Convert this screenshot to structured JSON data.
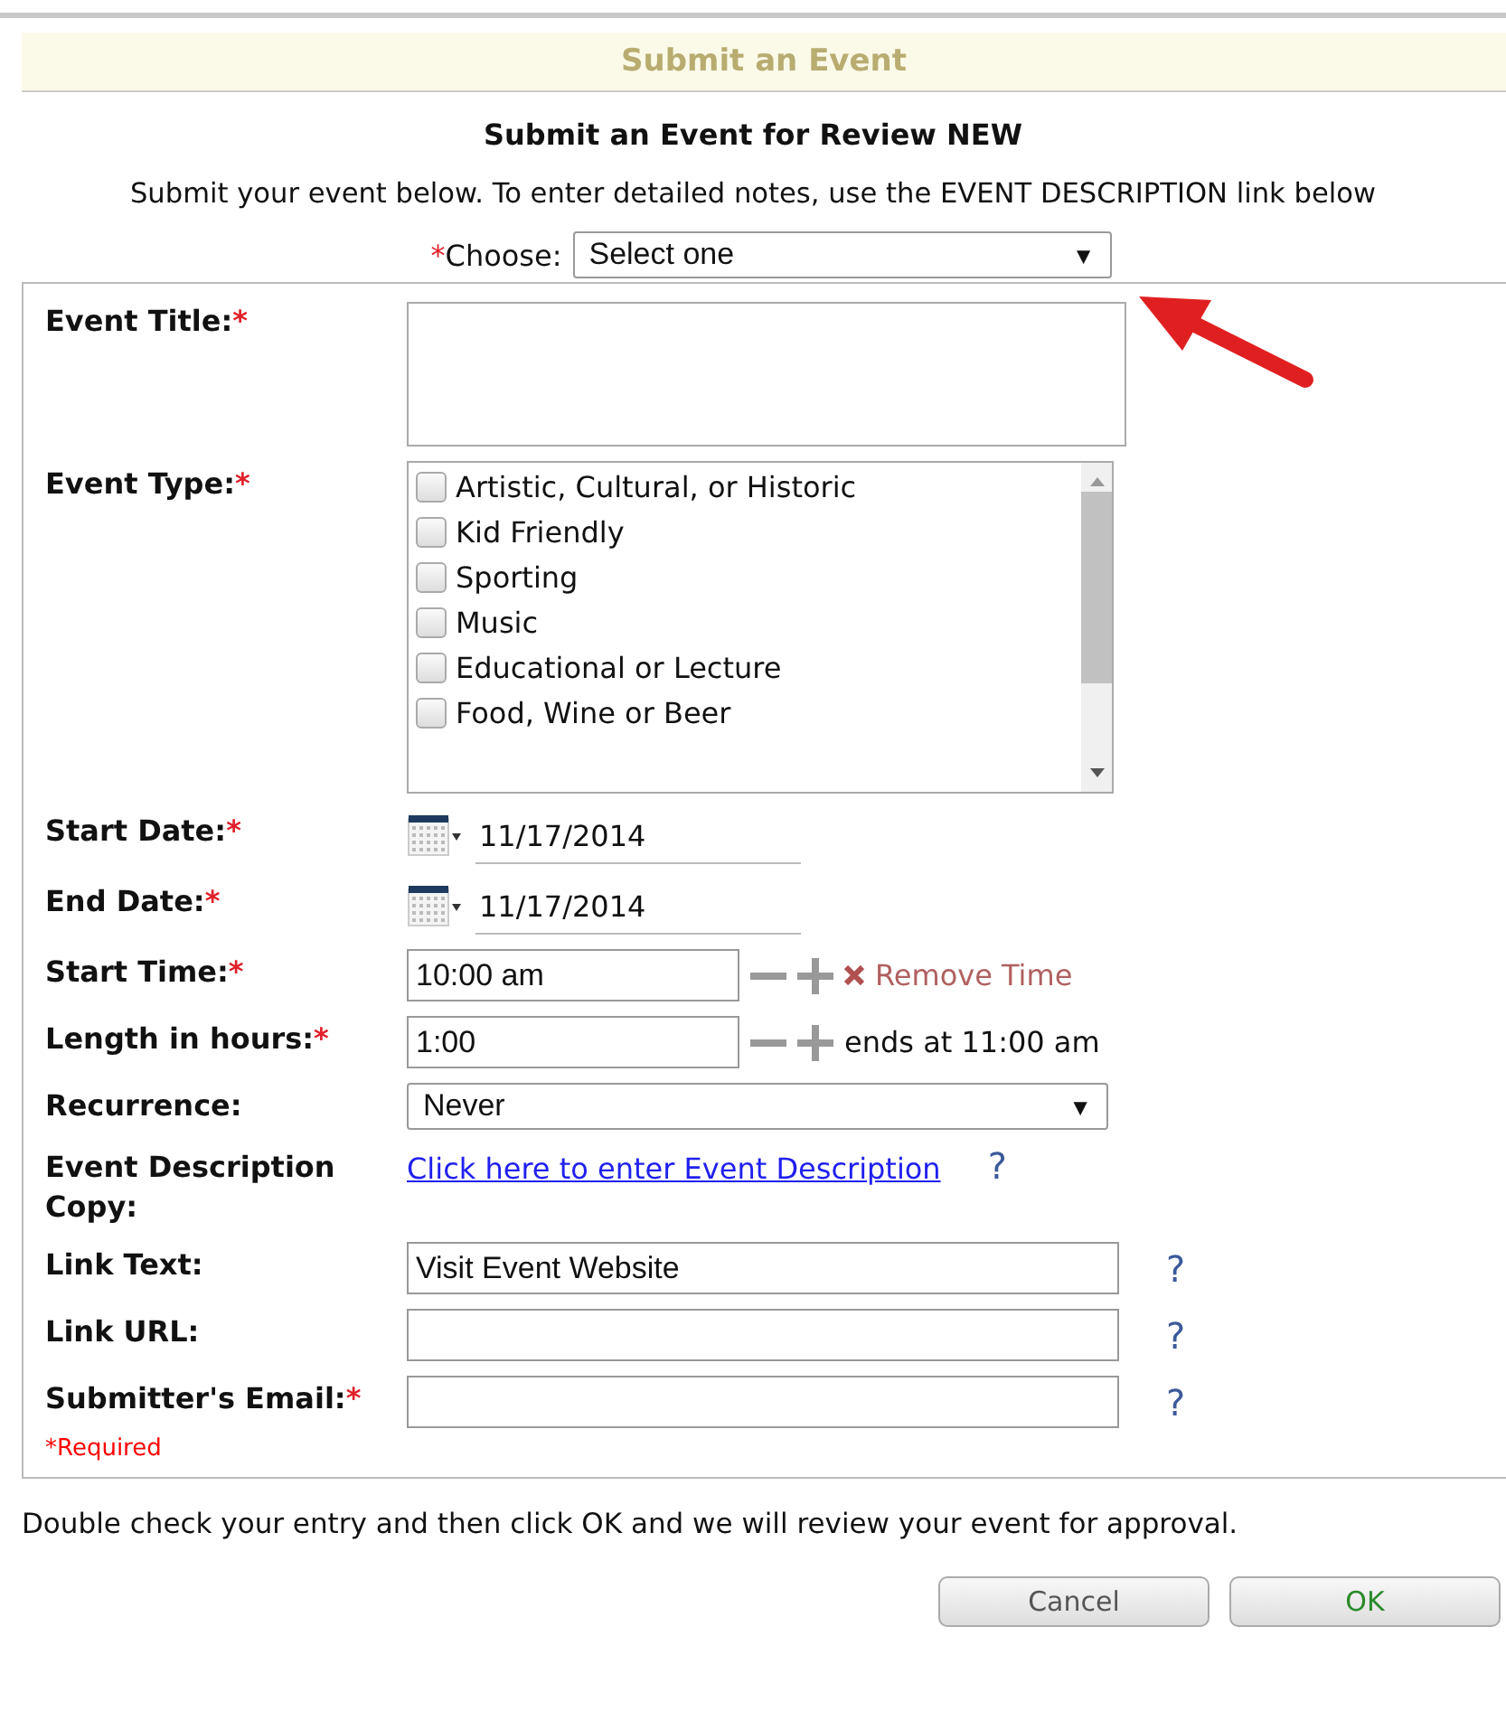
{
  "header": {
    "title": "Submit an Event"
  },
  "heading": "Submit an Event for Review NEW",
  "intro": "Submit your event below. To enter detailed notes, use the EVENT DESCRIPTION link below",
  "choose": {
    "mark": "*",
    "label": "Choose:",
    "value": "Select one",
    "caret": "▼"
  },
  "fields": [
    {
      "kind": "textarea",
      "label": "Event Title:",
      "mark": "*"
    },
    {
      "kind": "checklist",
      "label": "Event Type:",
      "mark": "*",
      "options": [
        {
          "label": "Artistic, Cultural, or Historic",
          "checked": false
        },
        {
          "label": "Kid Friendly",
          "checked": false
        },
        {
          "label": "Sporting",
          "checked": false
        },
        {
          "label": "Music",
          "checked": false
        },
        {
          "label": "Educational or Lecture",
          "checked": false
        },
        {
          "label": "Food, Wine or Beer",
          "checked": false
        }
      ]
    },
    {
      "kind": "date",
      "label": "Start Date:",
      "mark": "*",
      "value": "11/17/2014"
    },
    {
      "kind": "date",
      "label": "End Date:",
      "mark": "*",
      "value": "11/17/2014"
    },
    {
      "kind": "time",
      "label": "Start Time:",
      "mark": "*",
      "value": "10:00 am",
      "action": "Remove Time"
    },
    {
      "kind": "length",
      "label": "Length in hours:",
      "mark": "*",
      "value": "1:00",
      "note": "ends at 11:00 am"
    },
    {
      "kind": "select",
      "label": "Recurrence:",
      "value": "Never",
      "caret": "▼"
    },
    {
      "kind": "link",
      "label": "Event Description Copy:",
      "link": "Click here to enter Event Description",
      "help": "?"
    },
    {
      "kind": "text",
      "label": "Link Text:",
      "value": "Visit Event Website",
      "help": "?"
    },
    {
      "kind": "text",
      "label": "Link URL:",
      "help": "?"
    },
    {
      "kind": "text",
      "label": "Submitter's Email:",
      "mark": "*",
      "help": "?"
    }
  ],
  "required_note": "*Required",
  "footer_text": "Double check your entry and then click OK and we will review your event for approval.",
  "buttons": [
    {
      "label": "Cancel",
      "kind": "secondary"
    },
    {
      "label": "OK",
      "kind": "primary"
    }
  ]
}
